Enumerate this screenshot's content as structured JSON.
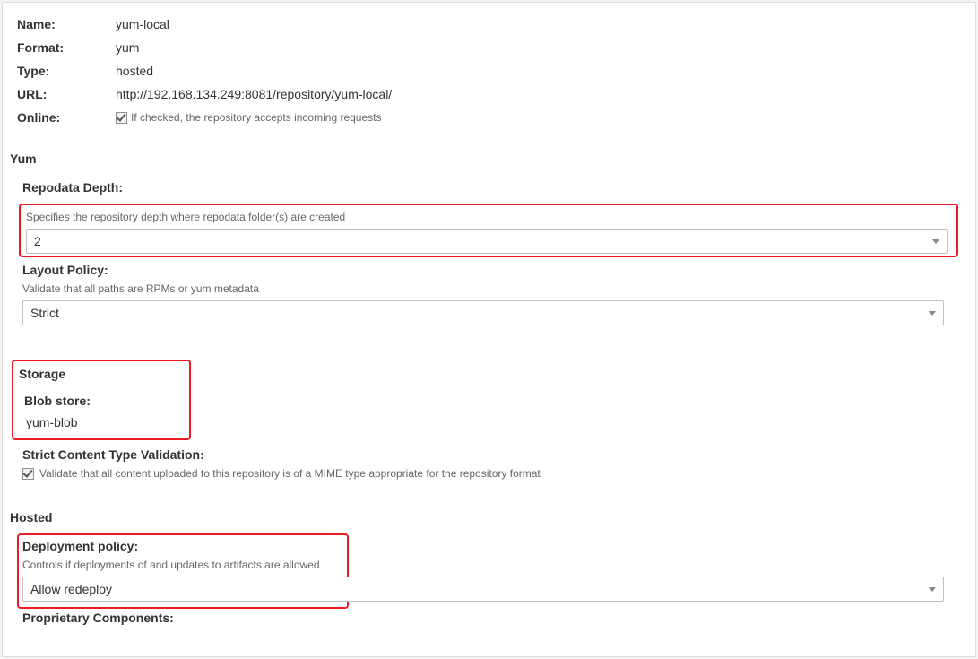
{
  "info": {
    "name_label": "Name:",
    "name_value": "yum-local",
    "format_label": "Format:",
    "format_value": "yum",
    "type_label": "Type:",
    "type_value": "hosted",
    "url_label": "URL:",
    "url_value": "http://192.168.134.249:8081/repository/yum-local/",
    "online_label": "Online:",
    "online_hint": "If checked, the repository accepts incoming requests"
  },
  "yum": {
    "section": "Yum",
    "repodata_label": "Repodata Depth:",
    "repodata_hint": "Specifies the repository depth where repodata folder(s) are created",
    "repodata_value": "2",
    "layout_label": "Layout Policy:",
    "layout_hint": "Validate that all paths are RPMs or yum metadata",
    "layout_value": "Strict"
  },
  "storage": {
    "section": "Storage",
    "blob_label": "Blob store:",
    "blob_value": "yum-blob",
    "strict_label": "Strict Content Type Validation:",
    "strict_hint": "Validate that all content uploaded to this repository is of a MIME type appropriate for the repository format"
  },
  "hosted": {
    "section": "Hosted",
    "deploy_label": "Deployment policy:",
    "deploy_hint": "Controls if deployments of and updates to artifacts are allowed",
    "deploy_value": "Allow redeploy",
    "proprietary_label": "Proprietary Components:"
  }
}
